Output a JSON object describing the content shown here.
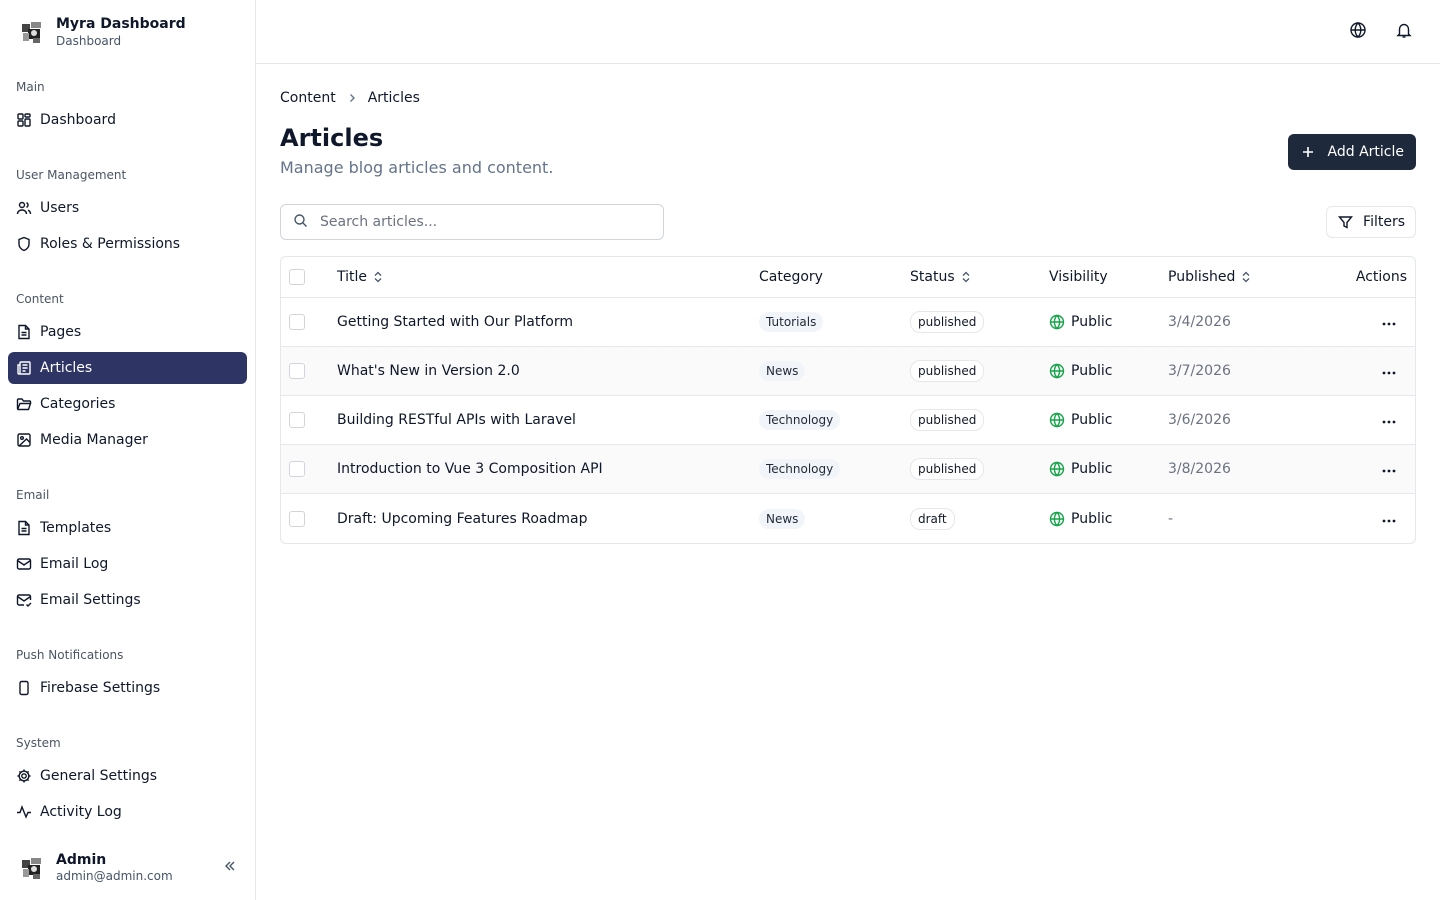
{
  "brand": {
    "title": "Myra Dashboard",
    "subtitle": "Dashboard"
  },
  "sidebar": {
    "sections": [
      {
        "label": "Main",
        "items": [
          {
            "label": "Dashboard",
            "icon": "grid-icon"
          }
        ]
      },
      {
        "label": "User Management",
        "items": [
          {
            "label": "Users",
            "icon": "users-icon"
          },
          {
            "label": "Roles & Permissions",
            "icon": "shield-icon"
          }
        ]
      },
      {
        "label": "Content",
        "items": [
          {
            "label": "Pages",
            "icon": "file-icon"
          },
          {
            "label": "Articles",
            "icon": "newspaper-icon",
            "active": true
          },
          {
            "label": "Categories",
            "icon": "folder-icon"
          },
          {
            "label": "Media Manager",
            "icon": "image-icon"
          }
        ]
      },
      {
        "label": "Email",
        "items": [
          {
            "label": "Templates",
            "icon": "file-icon"
          },
          {
            "label": "Email Log",
            "icon": "mail-icon"
          },
          {
            "label": "Email Settings",
            "icon": "mail-check-icon"
          }
        ]
      },
      {
        "label": "Push Notifications",
        "items": [
          {
            "label": "Firebase Settings",
            "icon": "phone-icon"
          }
        ]
      },
      {
        "label": "System",
        "items": [
          {
            "label": "General Settings",
            "icon": "gear-icon"
          },
          {
            "label": "Activity Log",
            "icon": "activity-icon"
          }
        ]
      }
    ],
    "user": {
      "name": "Admin",
      "email": "admin@admin.com"
    }
  },
  "breadcrumb": {
    "parent": "Content",
    "current": "Articles"
  },
  "page": {
    "title": "Articles",
    "subtitle": "Manage blog articles and content.",
    "add_label": "Add Article",
    "search_placeholder": "Search articles...",
    "filters_label": "Filters"
  },
  "table": {
    "headers": {
      "title": "Title",
      "category": "Category",
      "status": "Status",
      "visibility": "Visibility",
      "published": "Published",
      "actions": "Actions"
    },
    "rows": [
      {
        "title": "Getting Started with Our Platform",
        "category": "Tutorials",
        "status": "published",
        "visibility": "Public",
        "published": "3/4/2026"
      },
      {
        "title": "What's New in Version 2.0",
        "category": "News",
        "status": "published",
        "visibility": "Public",
        "published": "3/7/2026"
      },
      {
        "title": "Building RESTful APIs with Laravel",
        "category": "Technology",
        "status": "published",
        "visibility": "Public",
        "published": "3/6/2026"
      },
      {
        "title": "Introduction to Vue 3 Composition API",
        "category": "Technology",
        "status": "published",
        "visibility": "Public",
        "published": "3/8/2026"
      },
      {
        "title": "Draft: Upcoming Features Roadmap",
        "category": "News",
        "status": "draft",
        "visibility": "Public",
        "published": "-"
      }
    ]
  },
  "colors": {
    "active_nav": "#2e3565",
    "primary_button": "#1e293b",
    "public_green": "#16a34a"
  }
}
